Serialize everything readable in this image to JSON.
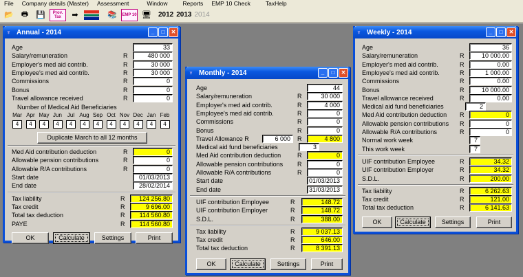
{
  "menu": [
    "File",
    "Company details (Master)",
    "Assessment",
    "Window",
    "Reports",
    "EMP 10 Check",
    "TaxHelp"
  ],
  "toolbar": {
    "prov_tax_label": "Prov. Tax",
    "emp10_label": "EMP 10",
    "years": [
      "2012",
      "2013",
      "2014"
    ]
  },
  "annual": {
    "title": "Annual - 2014",
    "rows": [
      {
        "label": "Age",
        "r": "",
        "value": "33",
        "yellow": false
      },
      {
        "label": "Salary/remuneration",
        "r": "R",
        "value": "480 000",
        "yellow": false
      },
      {
        "label": "Employer's med aid contrib.",
        "r": "R",
        "value": "30 000",
        "yellow": false
      },
      {
        "label": "Employee's med aid contrib.",
        "r": "R",
        "value": "30 000",
        "yellow": false
      },
      {
        "label": "Commissions",
        "r": "R",
        "value": "0",
        "yellow": false
      },
      {
        "label": "Bonus",
        "r": "R",
        "value": "0",
        "yellow": false
      },
      {
        "label": "Travel allowance received",
        "r": "R",
        "value": "0",
        "yellow": false
      }
    ],
    "beneficiaries_heading": "Number of Medical Aid Beneficiaries",
    "months": [
      "Mar",
      "Apr",
      "May",
      "Jun",
      "Jul",
      "Aug",
      "Sep",
      "Oct",
      "Nov",
      "Dec",
      "Jan",
      "Feb"
    ],
    "month_values": [
      "4",
      "4",
      "4",
      "4",
      "4",
      "4",
      "4",
      "4",
      "4",
      "4",
      "4",
      "4"
    ],
    "duplicate_label": "Duplicate March to all 12 months",
    "rows2": [
      {
        "label": "Med Aid contribution deduction",
        "r": "R",
        "value": "0",
        "yellow": true
      },
      {
        "label": "Allowable pension contributions",
        "r": "R",
        "value": "0",
        "yellow": false
      },
      {
        "label": "Allowable R/A contributions",
        "r": "R",
        "value": "0",
        "yellow": false
      },
      {
        "label": "Start date",
        "r": "",
        "value": "01/03/2013",
        "yellow": false
      },
      {
        "label": "End date",
        "r": "",
        "value": "28/02/2014",
        "yellow": false
      }
    ],
    "rows3": [
      {
        "label": "Tax liability",
        "r": "R",
        "value": "124 256.80",
        "yellow": true
      },
      {
        "label": "Tax credit",
        "r": "R",
        "value": "9 696.00",
        "yellow": true
      },
      {
        "label": "Total tax deduction",
        "r": "R",
        "value": "114 560.80",
        "yellow": true
      },
      {
        "label": "PAYE",
        "r": "R",
        "value": "114 560.80",
        "yellow": true
      }
    ]
  },
  "monthly": {
    "title": "Monthly - 2014",
    "rows": [
      {
        "label": "Age",
        "r": "",
        "value": "44",
        "yellow": false
      },
      {
        "label": "Salary/remuneration",
        "r": "R",
        "value": "30 000",
        "yellow": false
      },
      {
        "label": "Employer's med aid contrib.",
        "r": "R",
        "value": "4 000",
        "yellow": false
      },
      {
        "label": "Employee's med aid contrib.",
        "r": "R",
        "value": "0",
        "yellow": false
      },
      {
        "label": "Commissions",
        "r": "R",
        "value": "0",
        "yellow": false
      },
      {
        "label": "Bonus",
        "r": "R",
        "value": "0",
        "yellow": false
      }
    ],
    "travel_label": "Travel Allowance R",
    "travel_input": "6 000",
    "travel_value": "4 800",
    "benef_label": "Medical aid fund beneficiaries",
    "benef_value": "3",
    "rows2": [
      {
        "label": "Med Aid contribution deduction",
        "r": "R",
        "value": "0",
        "yellow": true
      },
      {
        "label": "Allowable pension contributions",
        "r": "R",
        "value": "0",
        "yellow": false
      },
      {
        "label": "Allowable R/A contributions",
        "r": "R",
        "value": "0",
        "yellow": false
      },
      {
        "label": "Start date",
        "r": "",
        "value": "01/03/2013",
        "yellow": false
      },
      {
        "label": "End date",
        "r": "",
        "value": "31/03/2013",
        "yellow": false
      }
    ],
    "rows3": [
      {
        "label": "UIF contribution Employee",
        "r": "R",
        "value": "148.72",
        "yellow": true
      },
      {
        "label": "UIF contribution Employer",
        "r": "R",
        "value": "148.72",
        "yellow": true
      },
      {
        "label": "S.D.L.",
        "r": "R",
        "value": "388.00",
        "yellow": true
      }
    ],
    "rows4": [
      {
        "label": "Tax liability",
        "r": "R",
        "value": "9 037.13",
        "yellow": true
      },
      {
        "label": "Tax credit",
        "r": "R",
        "value": "646.00",
        "yellow": true
      },
      {
        "label": "Total tax deduction",
        "r": "R",
        "value": "8 391.13",
        "yellow": true
      }
    ]
  },
  "weekly": {
    "title": "Weekly - 2014",
    "rows": [
      {
        "label": "Age",
        "r": "",
        "value": "36",
        "yellow": false
      },
      {
        "label": "Salary/remuneration",
        "r": "R",
        "value": "10 000.00",
        "yellow": false
      },
      {
        "label": "Employer's med aid contrib.",
        "r": "R",
        "value": "0.00",
        "yellow": false
      },
      {
        "label": "Employee's med aid contrib.",
        "r": "R",
        "value": "1 000.00",
        "yellow": false
      },
      {
        "label": "Commissions",
        "r": "R",
        "value": "0.00",
        "yellow": false
      },
      {
        "label": "Bonus",
        "r": "R",
        "value": "10 000.00",
        "yellow": false
      },
      {
        "label": "Travel allowance received",
        "r": "R",
        "value": "0.00",
        "yellow": false
      }
    ],
    "benef_label": "Medical aid fund beneficiaries",
    "benef_value": "2",
    "rows2": [
      {
        "label": "Med Aid contribution deduction",
        "r": "R",
        "value": "0",
        "yellow": true
      },
      {
        "label": "Allowable pension contributions",
        "r": "R",
        "value": "0",
        "yellow": false
      },
      {
        "label": "Allowable R/A contributions",
        "r": "R",
        "value": "0",
        "yellow": false
      },
      {
        "label": "Normal work week",
        "r": "",
        "value": "7",
        "yellow": false
      },
      {
        "label": "This work week",
        "r": "",
        "value": "7",
        "yellow": false
      }
    ],
    "rows3": [
      {
        "label": "UIF contribution Employee",
        "r": "R",
        "value": "34.32",
        "yellow": true
      },
      {
        "label": "UIF contribution Employer",
        "r": "R",
        "value": "34.32",
        "yellow": true
      },
      {
        "label": "S.D.L.",
        "r": "R",
        "value": "200.00",
        "yellow": true
      }
    ],
    "rows4": [
      {
        "label": "Tax liability",
        "r": "R",
        "value": "6 262.63",
        "yellow": true
      },
      {
        "label": "Tax credit",
        "r": "R",
        "value": "121.00",
        "yellow": true
      },
      {
        "label": "Total tax deduction",
        "r": "R",
        "value": "6 141.63",
        "yellow": true
      }
    ]
  },
  "buttons": {
    "ok": "OK",
    "calculate": "Calculate",
    "settings": "Settings",
    "print": "Print"
  },
  "colors": {
    "titlebar": "#0a58e0",
    "highlight": "#ffff00",
    "background": "#d4d0c8"
  }
}
